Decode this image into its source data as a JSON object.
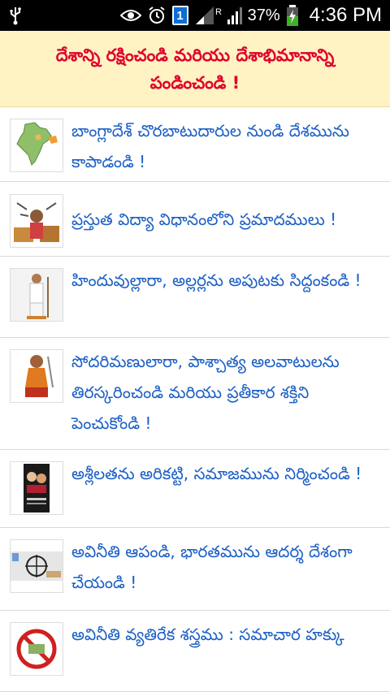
{
  "status_bar": {
    "usb_icon": "usb-icon",
    "eye_icon": "eye-icon",
    "alarm_icon": "alarm-icon",
    "sim_badge": "1",
    "signal_roaming": "R",
    "battery_percent": "37%",
    "time": "4:36 PM"
  },
  "banner": {
    "title": "దేశాన్ని రక్షించండి మరియు దేశాభిమానాన్ని పండించండి !"
  },
  "articles": [
    {
      "title": "బాంగ్లాదేశ్ చొరబాటుదారుల నుండి దేశమును కాపాడండి !",
      "thumb": "india-map-thumbnail"
    },
    {
      "title": "ప్రస్తుత విద్యా విధానంలోని ప్రమాదములు !",
      "thumb": "student-books-thumbnail"
    },
    {
      "title": "హిందువుల్లారా, అల్లర్లను అపుటకు సిద్దంకండి !",
      "thumb": "leader-standing-thumbnail"
    },
    {
      "title": "సోదరిమణులారా, పాశ్చాత్య అలవాటులను తిరస్కరించండి మరియు ప్రతీకార శక్తిని పెంచుకోండి !",
      "thumb": "warrior-woman-thumbnail"
    },
    {
      "title": "అశ్లీలతను అరికట్టి, సమాజమును నిర్మించండి !",
      "thumb": "poster-thumbnail"
    },
    {
      "title": "అవినీతి ఆపండి, భారతమును ఆదర్శ దేశంగా చేయండి !",
      "thumb": "corruption-thumbnail"
    },
    {
      "title": "అవినీతి వ్యతిరేక శస్త్రము : సమాచార హక్కు",
      "thumb": "anti-corruption-thumbnail"
    }
  ],
  "colors": {
    "banner_bg": "#fff3c4",
    "banner_text": "#e0002a",
    "item_text": "#1a5fc5"
  }
}
